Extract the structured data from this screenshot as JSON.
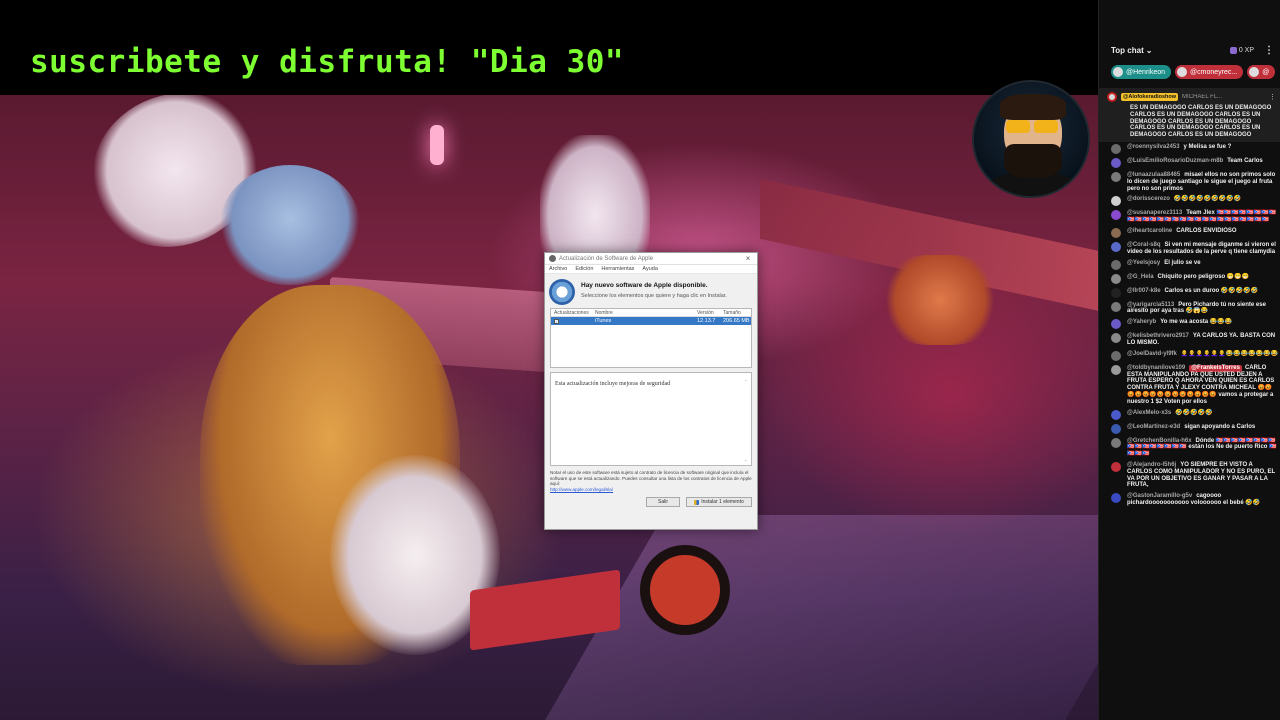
{
  "banner": {
    "text": "suscribete y disfruta! \"Dia 30\""
  },
  "dialog": {
    "title": "Actualización de Software de Apple",
    "close": "×",
    "menu": [
      "Archivo",
      "Edición",
      "Herramientas",
      "Ayuda"
    ],
    "header": "Hay nuevo software de Apple disponible.",
    "subheader": "Seleccione los elementos que quiere y haga clic en Instalar.",
    "columns": {
      "updates": "Actualizaciones",
      "name": "Nombre",
      "version": "Versión",
      "size": "Tamaño"
    },
    "item": {
      "name": "iTunes",
      "version": "12.13.7",
      "size": "206.65 MB",
      "checked": true
    },
    "description": "Esta actualización incluye mejoras de seguridad",
    "legal": "Notar el uso de este software está sujeto al contrato de licencia de software original que incluía el software que se está actualizando. Puedes consultar una lista de los contratos de licencia de Apple aquí:",
    "legal_link": "http://www.apple.com/legal/sla/",
    "quit_button": "Salir",
    "install_button": "Instalar 1 elemento"
  },
  "chat": {
    "mode": "Top chat",
    "xp": "0 XP",
    "pinned_users": [
      "@Henrikeon",
      "@cmoneyrec...",
      "@"
    ],
    "pinned_message": {
      "author": "@Alofokeradioshow",
      "author2": "MICHAEL FL...",
      "text": "ES UN DEMAGOGO CARLOS ES UN DEMAGOGO CARLOS ES UN DEMAGOGO CARLOS ES UN DEMAGOGO CARLOS ES UN DEMAGOGO CARLOS ES UN DEMAGOGO CARLOS ES UN DEMAGOGO CARLOS ES UN DEMAGOGO"
    },
    "messages": [
      {
        "author": "@roennysilva2453",
        "text": "y Melisa se fue ?",
        "color": "#6b6b6b"
      },
      {
        "author": "@LuisEmilioRosarioDuzman-m8b",
        "text": "Team Carlos",
        "color": "#6a5ac8"
      },
      {
        "author": "@lunaazulaa88465",
        "text": "misael ellos no son primos solo lo dicen de juego santiago le sigue el juego al fruta pero no son primos",
        "color": "#7a7a7a"
      },
      {
        "author": "@dorisscerezo",
        "text": "🤣🤣🤣🤣🤣🤣🤣🤣🤣",
        "color": "#cfcfcf"
      },
      {
        "author": "@susanaperez3113",
        "text": "Team Jlex 🇵🇷🇵🇷🇵🇷🇵🇷🇵🇷🇵🇷🇵🇷🇵🇷🇵🇷🇵🇷🇵🇷🇵🇷🇵🇷🇵🇷🇵🇷🇵🇷🇵🇷🇵🇷🇵🇷🇵🇷🇵🇷🇵🇷🇵🇷🇵🇷🇵🇷🇵🇷🇵🇷",
        "color": "#8a4ad0"
      },
      {
        "author": "@iheartcaroline",
        "text": "CARLOS ENVIDIOSO",
        "color": "#8a6a50"
      },
      {
        "author": "@Coral-s8q",
        "text": "Si ven mi mensaje diganme si vieron el video de los resultados de la perve q tiene clamydia",
        "color": "#5a6ac8"
      },
      {
        "author": "@Yeelsjosy",
        "text": "El julio se ve",
        "color": "#6b6b6b"
      },
      {
        "author": "@G_Hela",
        "text": "Chiquito pero peligroso 😁😁😁",
        "color": "#8a8a8a"
      },
      {
        "author": "@llr007-k8e",
        "text": "Carlos es un duroo 🤣🤣🤣🤣🤣",
        "color": "#222"
      },
      {
        "author": "@yarigarcia5113",
        "text": "Pero Pichardo tú no siente ese airesito por aya tras 🤣😱😂",
        "color": "#7a7a7a"
      },
      {
        "author": "@Yaheryb",
        "text": "Yo me wa acosta 😂😂😂",
        "color": "#6a5ac8"
      },
      {
        "author": "@kelisbethrivero2917",
        "text": "YA CARLOS YA. BASTA CON LO MISMO.",
        "color": "#8a8a8a"
      },
      {
        "author": "@JoelDavid-yl9fk",
        "text": "👩‍🦲👩‍🦲👩‍🦲👩‍🦲👩‍🦲👩‍🦲😂😂😂😂😂😂😂",
        "color": "#6b6b6b"
      },
      {
        "author": "@toldbynanilove109",
        "text": "CARLO ESTA MANIPULANDO PA QUE USTED DEJEN A FRUTA ESPERO Q AHORA VEN QUIEN ES CARLOS CONTRA FRUTA Y JLEXY CONTRA MICHEAL 😡😡😡😡😡😡😡😡😡😡😡😡😡😡 vamos a protegar a nuestro 1 $2 Voten por ellos",
        "color": "#9a9a9a",
        "mention": "@FrankeisTorres"
      },
      {
        "author": "@AlexMelo-x3s",
        "text": "🤣🤣🤣🤣🤣",
        "color": "#4a5ac8"
      },
      {
        "author": "@LeoMartinez-e3d",
        "text": "sigan apoyando a Carlos",
        "color": "#3a5ab0"
      },
      {
        "author": "@GretchenBonilla-h6x",
        "text": "Dónde 🇵🇷🇵🇷🇵🇷🇵🇷🇵🇷🇵🇷🇵🇷🇵🇷🇵🇷🇵🇷🇵🇷🇵🇷🇵🇷🇵🇷🇵🇷🇵🇷 están los Ne de puerto Rico 🇵🇷🇵🇷🇵🇷🇵🇷",
        "color": "#7a7a7a"
      },
      {
        "author": "@Alejandro-l5h6j",
        "text": "YO SIEMPRE EH VISTO A CARLOS COMO MANIPULADOR Y NO ES PURO, EL VA POR UN OBJETIVO ES GANAR Y PASAR A LA FRUTA,",
        "color": "#c0303a"
      },
      {
        "author": "@GastonJaramillo-g5v",
        "text": "cagoooo pichardooooooooooo voloooooo el bebé 🤣🤣",
        "color": "#3a4ac0"
      }
    ]
  }
}
